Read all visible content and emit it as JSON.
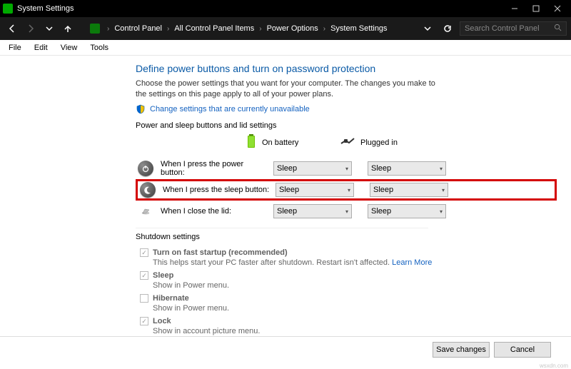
{
  "window": {
    "title": "System Settings"
  },
  "breadcrumb": {
    "items": [
      "Control Panel",
      "All Control Panel Items",
      "Power Options",
      "System Settings"
    ]
  },
  "search": {
    "placeholder": "Search Control Panel"
  },
  "menubar": {
    "items": [
      "File",
      "Edit",
      "View",
      "Tools"
    ]
  },
  "main": {
    "heading": "Define power buttons and turn on password protection",
    "description": "Choose the power settings that you want for your computer. The changes you make to the settings on this page apply to all of your power plans.",
    "change_link": "Change settings that are currently unavailable",
    "section1_title": "Power and sleep buttons and lid settings",
    "cols": {
      "battery": "On battery",
      "plugged": "Plugged in"
    },
    "rows": [
      {
        "label": "When I press the power button:",
        "battery": "Sleep",
        "plugged": "Sleep"
      },
      {
        "label": "When I press the sleep button:",
        "battery": "Sleep",
        "plugged": "Sleep"
      },
      {
        "label": "When I close the lid:",
        "battery": "Sleep",
        "plugged": "Sleep"
      }
    ],
    "section2_title": "Shutdown settings",
    "shutdown": {
      "fast": {
        "label": "Turn on fast startup (recommended)",
        "sub": "This helps start your PC faster after shutdown. Restart isn't affected. ",
        "link": "Learn More",
        "checked": true
      },
      "sleep": {
        "label": "Sleep",
        "sub": "Show in Power menu.",
        "checked": true
      },
      "hiber": {
        "label": "Hibernate",
        "sub": "Show in Power menu.",
        "checked": false
      },
      "lock": {
        "label": "Lock",
        "sub": "Show in account picture menu.",
        "checked": true
      }
    }
  },
  "footer": {
    "save": "Save changes",
    "cancel": "Cancel"
  },
  "watermark": "wsxdn.com"
}
